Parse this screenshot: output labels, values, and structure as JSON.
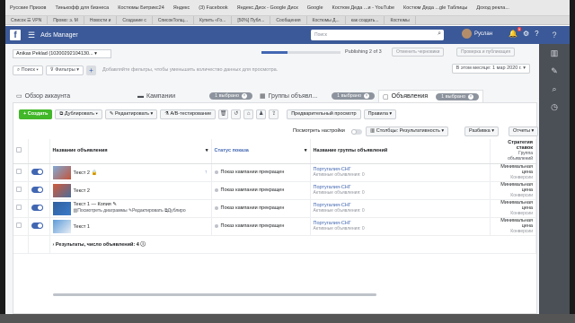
{
  "bookmarks": [
    "Русские Призов",
    "Тинькофф для бизнеса",
    "Костюмы Битрикс24",
    "Яндекс",
    "(3) Facebook",
    "Яндекс.Диск - Google Диск",
    "Google",
    "Костюм Деда ...и - YouTube",
    "Костюм Деда ...gle Таблицы",
    "Доход рекла..."
  ],
  "tabs": [
    "Список ☰ VPN",
    "Промо: э. M",
    "Новости и",
    "Создание с",
    "СписокТолщ...",
    "Купить «Го...",
    "[50%] Публ...",
    "Сообщения",
    "Костюмы Д...",
    "как создать...",
    "Костюмы"
  ],
  "fb": {
    "title": "Ads Manager",
    "search_placeholder": "Поиск",
    "user": "Руслан",
    "notif_count": "9"
  },
  "account": {
    "name": "Anikas Peklad (10200292104130..."
  },
  "publish": {
    "status": "Publishing 2 of 3",
    "progress": 0.33,
    "discard": "Отменить черновики",
    "review": "Проверка и публикация"
  },
  "filters": {
    "search": "Поиск",
    "filters": "Фильтры",
    "hint": "Добавляйте фильтры, чтобы уменьшить количество данных для просмотра.",
    "date": "В этом месяце: 1 мар 2020 г."
  },
  "levels": {
    "overview": "Обзор аккаунта",
    "campaigns": "Кампании",
    "campaigns_sel": "1 выбрано",
    "adsets": "Группы объявл...",
    "adsets_sel": "1 выбрано",
    "ads": "Объявления",
    "ads_sel": "1 выбрано"
  },
  "toolbar": {
    "create": "Создать",
    "duplicate": "Дублировать",
    "edit": "Редактировать",
    "abtest": "A/B-тестирование",
    "preview": "Предварительный просмотр",
    "rules": "Правила"
  },
  "row2": {
    "view_settings": "Посмотреть настройки",
    "columns": "Столбцы: Результативность",
    "breakdown": "Разбивка",
    "reports": "Отчеты"
  },
  "columns": {
    "name": "Название объявления",
    "status": "Статус показа",
    "adset": "Название группы объявлений",
    "strategy": "Стратегия ставок",
    "strategy_sub": "Группа объявлений"
  },
  "rows": [
    {
      "name": "Текст 2",
      "status": "Показ кампании прекращен",
      "adset": "Португалия-СНГ",
      "adset_sub": "Активные объявления: 0",
      "strategy": "Минимальная цена",
      "strategy_sub": "Конверсии"
    },
    {
      "name": "Текст 2",
      "status": "Показ кампании прекращен",
      "adset": "Португалия-СНГ",
      "adset_sub": "Активные объявления: 0",
      "strategy": "Минимальная цена",
      "strategy_sub": "Конверсии"
    },
    {
      "name": "Текст 1 — Копия",
      "status": "Показ кампании прекращен",
      "adset": "Португалия-СНГ",
      "adset_sub": "Активные объявления: 0",
      "strategy": "Минимальная цена",
      "strategy_sub": "Конверсии",
      "actions": {
        "charts": "Посмотреть диаграммы",
        "edit": "Редактировать",
        "dup": "Дублиро"
      }
    },
    {
      "name": "Текст 1",
      "status": "Показ кампании прекращен",
      "adset": "Португалия-СНГ",
      "adset_sub": "Активные объявления: 0",
      "strategy": "Минимальная цена",
      "strategy_sub": "Конверсии"
    }
  ],
  "footer": {
    "results": "Результаты, число объявлений: 4"
  }
}
